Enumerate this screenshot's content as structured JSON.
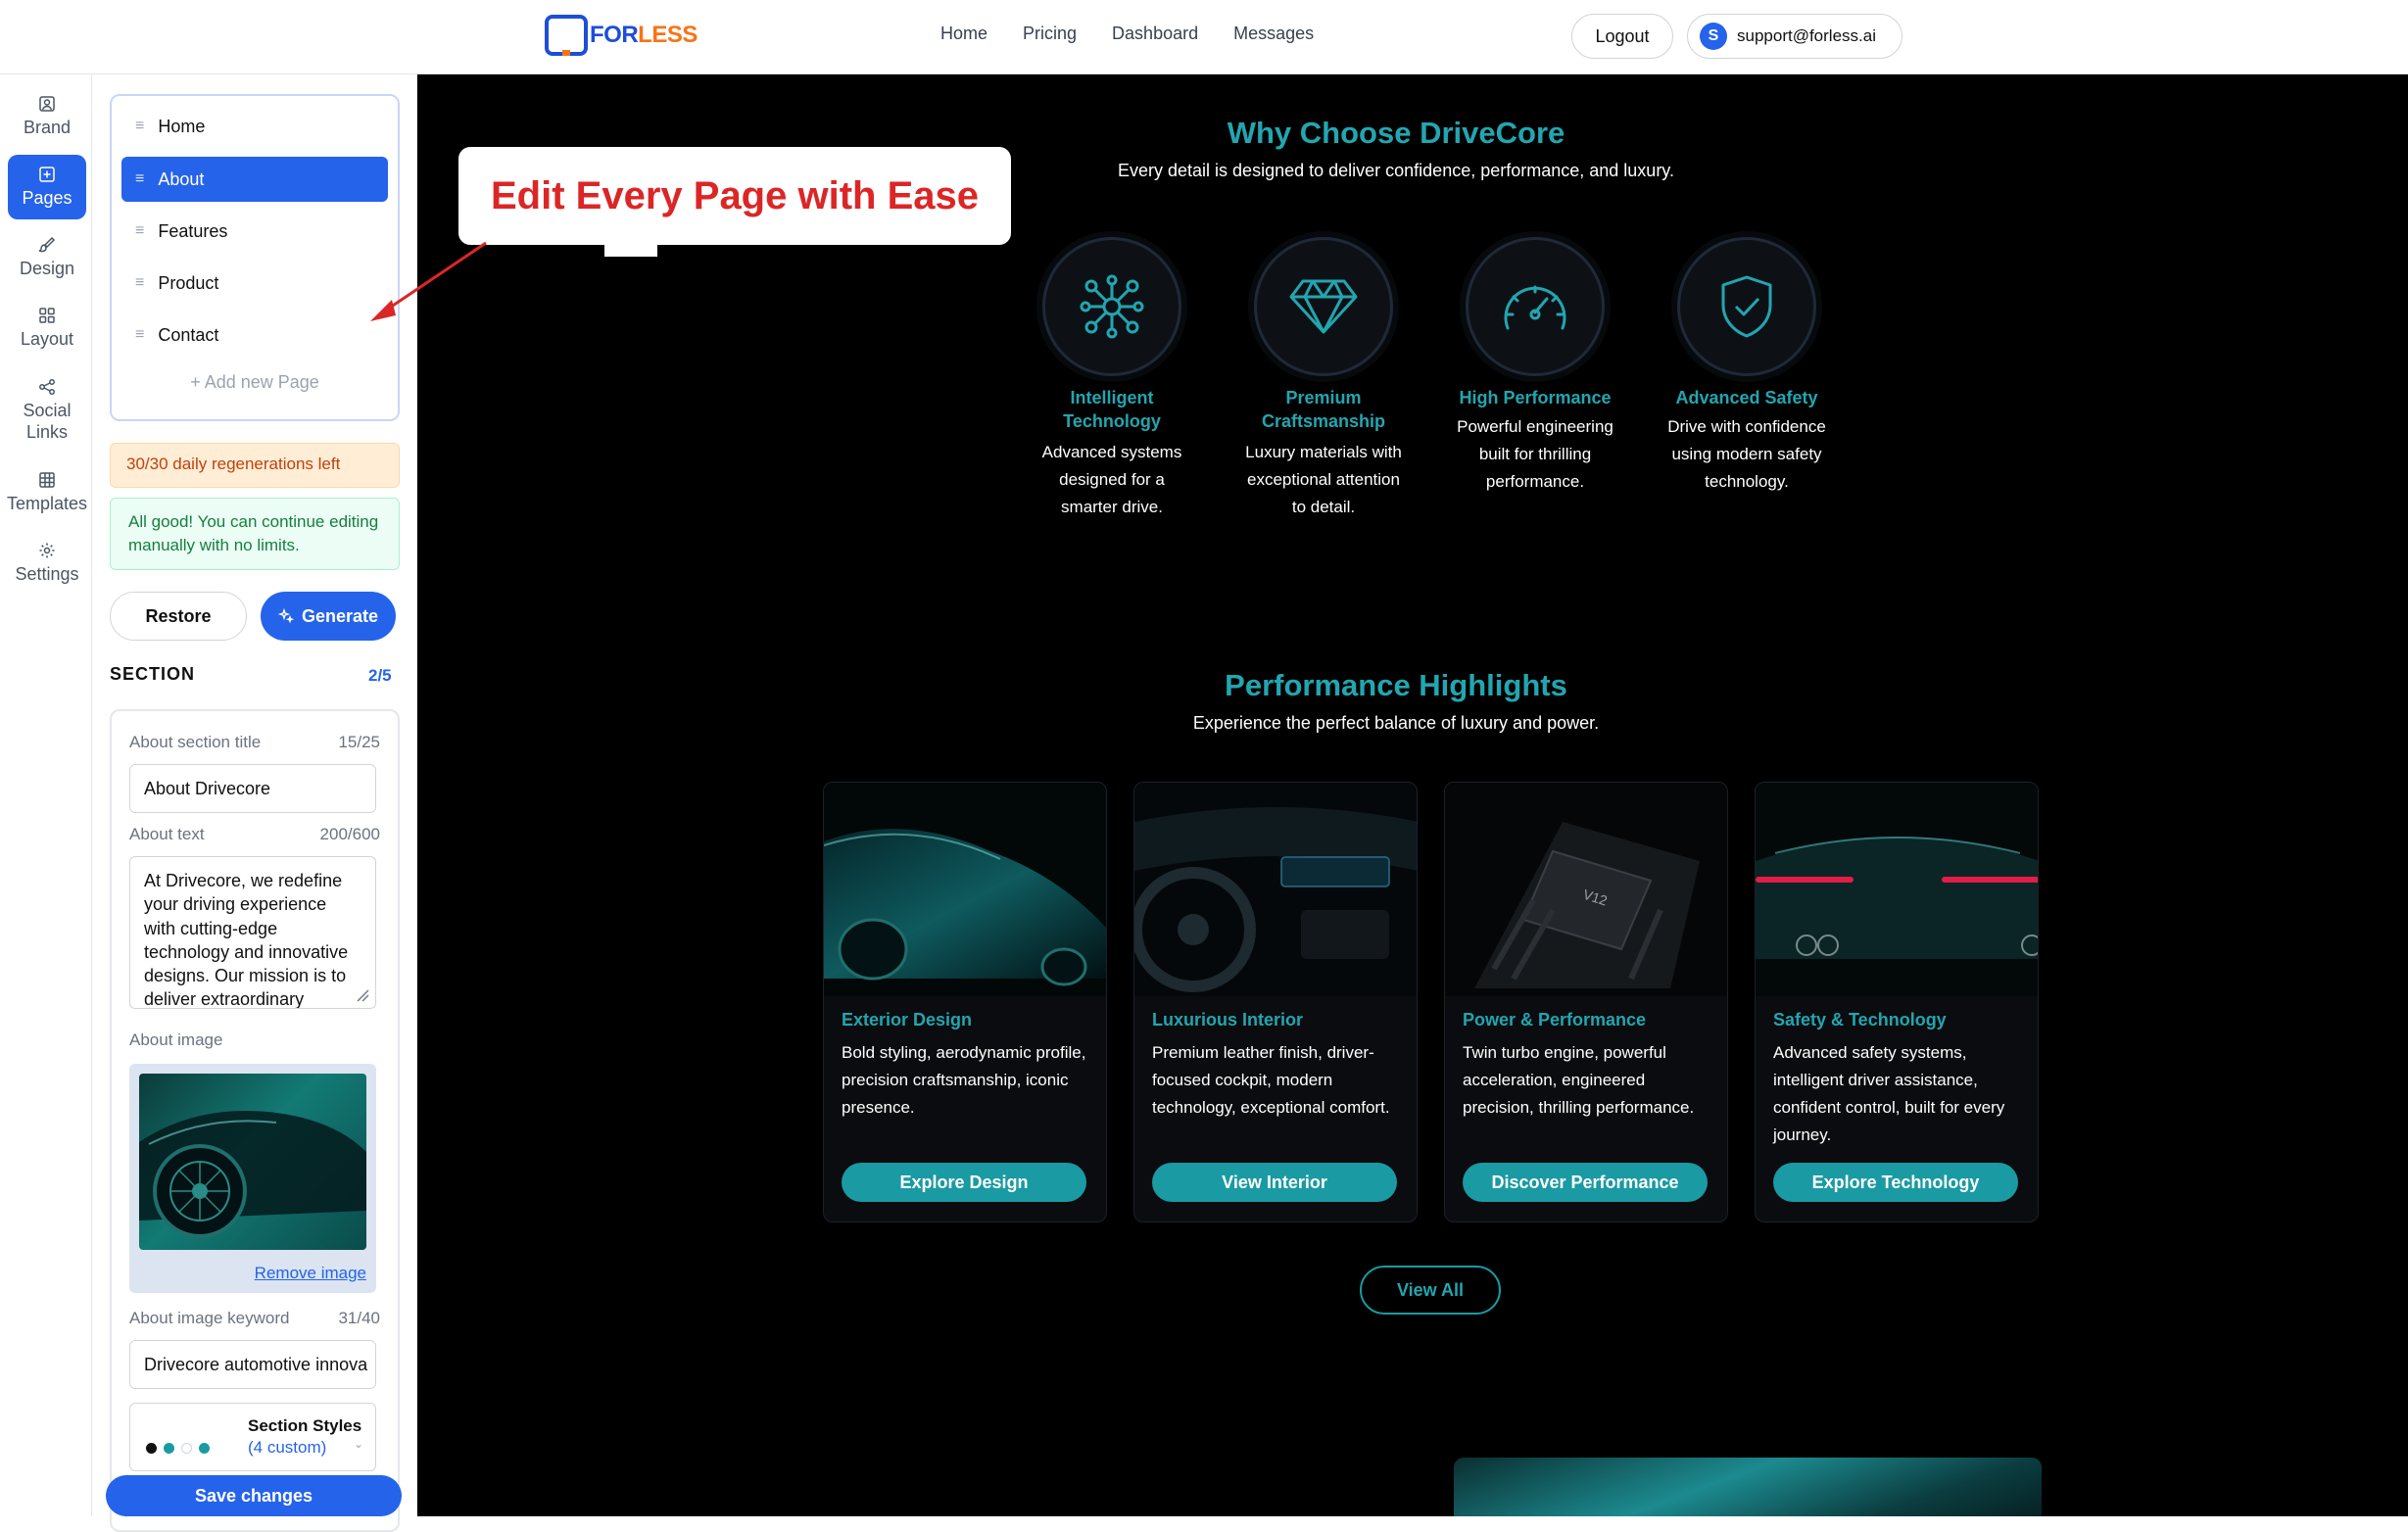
{
  "nav": {
    "logo_part1": "FOR",
    "logo_part2": "LESS",
    "links": [
      "Home",
      "Pricing",
      "Dashboard",
      "Messages"
    ],
    "logout_label": "Logout",
    "user_initial": "S",
    "user_email": "support@forless.ai"
  },
  "rail": {
    "items": [
      {
        "label": "Brand",
        "icon": "user-square-icon"
      },
      {
        "label": "Pages",
        "icon": "plus-square-icon"
      },
      {
        "label": "Design",
        "icon": "brush-icon"
      },
      {
        "label": "Layout",
        "icon": "grid-icon"
      },
      {
        "label": "Social Links",
        "icon": "share-icon"
      },
      {
        "label": "Templates",
        "icon": "table-icon"
      },
      {
        "label": "Settings",
        "icon": "gear-icon"
      }
    ],
    "active": "Pages"
  },
  "editor": {
    "pages": [
      "Home",
      "About",
      "Features",
      "Product",
      "Contact"
    ],
    "active_page": "About",
    "add_page_label": "+  Add new Page",
    "regen_notice": "30/30 daily regenerations left",
    "ok_notice": "All good! You can continue editing manually with no limits.",
    "restore_label": "Restore",
    "generate_label": "Generate",
    "section_label": "SECTION",
    "section_count": "2/5",
    "fields": {
      "title_label": "About section title",
      "title_count": "15/25",
      "title_value": "About Drivecore",
      "text_label": "About text",
      "text_count": "200/600",
      "text_value": "At Drivecore, we redefine your driving experience with cutting-edge technology and innovative designs. Our mission is to deliver extraordinary",
      "image_label": "About image",
      "remove_image_label": "Remove image",
      "keyword_label": "About image keyword",
      "keyword_count": "31/40",
      "keyword_value": "Drivecore automotive innova",
      "styles_label": "Section Styles",
      "styles_suffix": "(4 custom)"
    },
    "save_label": "Save changes"
  },
  "callout": {
    "text": "Edit Every Page with Ease"
  },
  "preview": {
    "why_title": "Why Choose DriveCore",
    "why_sub": "Every detail is designed to deliver confidence, performance, and luxury.",
    "features": [
      {
        "title": "Intelligent Technology",
        "desc": "Advanced systems designed for a smarter drive.",
        "icon": "network-icon"
      },
      {
        "title": "Premium Craftsmanship",
        "desc": "Luxury materials with exceptional attention to detail.",
        "icon": "diamond-icon"
      },
      {
        "title": "High Performance",
        "desc": "Powerful engineering built for thrilling performance.",
        "icon": "speedometer-icon"
      },
      {
        "title": "Advanced Safety",
        "desc": "Drive with confidence using modern safety technology.",
        "icon": "shield-check-icon"
      }
    ],
    "perf_title": "Performance Highlights",
    "perf_sub": "Experience the perfect balance of luxury and power.",
    "cards": [
      {
        "title": "Exterior Design",
        "desc": "Bold styling, aerodynamic profile, precision craftsmanship, iconic presence.",
        "button": "Explore Design"
      },
      {
        "title": "Luxurious Interior",
        "desc": "Premium leather finish, driver-focused cockpit, modern technology, exceptional comfort.",
        "button": "View Interior"
      },
      {
        "title": "Power & Performance",
        "desc": "Twin turbo engine, powerful acceleration, engineered precision, thrilling performance.",
        "button": "Discover Performance"
      },
      {
        "title": "Safety & Technology",
        "desc": "Advanced safety systems, intelligent driver assistance, confident control, built for every journey.",
        "button": "Explore Technology"
      }
    ],
    "view_all_label": "View All"
  },
  "colors": {
    "accent": "#2563eb",
    "teal": "#22a6b0",
    "callout_red": "#dc2626"
  }
}
